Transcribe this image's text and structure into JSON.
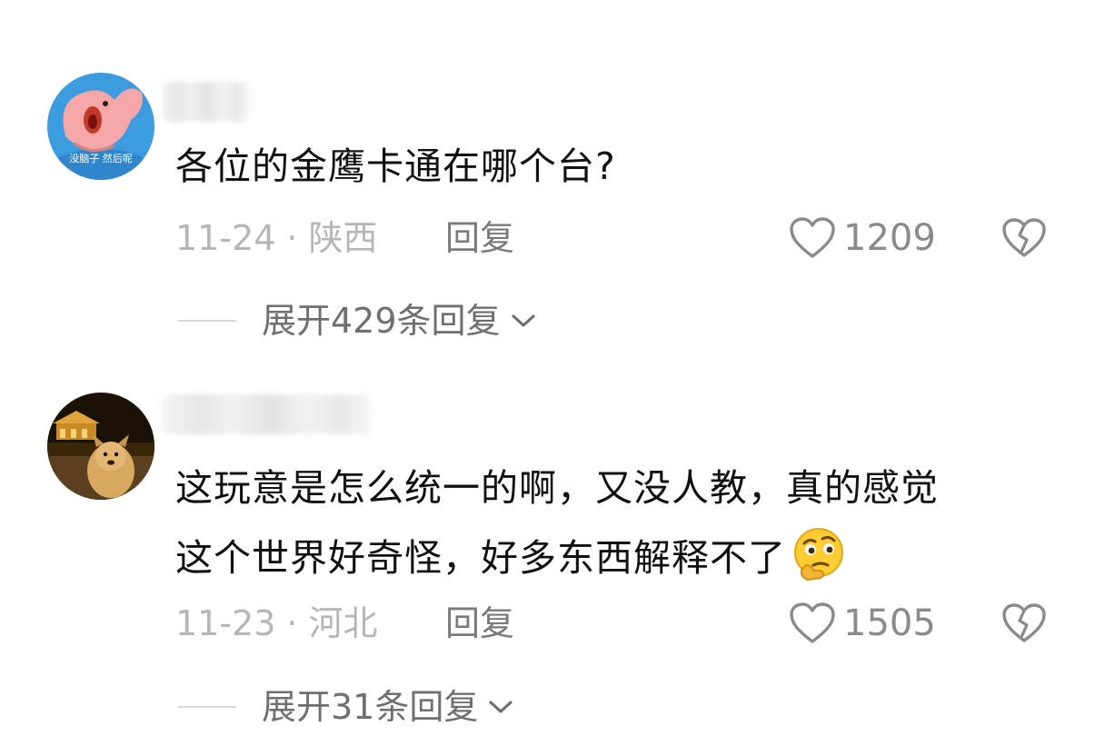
{
  "comments": [
    {
      "text": "各位的金鹰卡通在哪个台?",
      "date": "11-24",
      "separator": "·",
      "location": "陕西",
      "reply_label": "回复",
      "likes": "1209",
      "expand_label": "展开429条回复",
      "avatar_caption": "没脑子 然后呢"
    },
    {
      "text_line1": "这玩意是怎么统一的啊，又没人教，真的感觉",
      "text_line2": "这个世界好奇怪，好多东西解释不了",
      "date": "11-23",
      "separator": "·",
      "location": "河北",
      "reply_label": "回复",
      "likes": "1505",
      "expand_label": "展开31条回复"
    }
  ],
  "colors": {
    "text": "#111111",
    "meta": "#b6b6b6",
    "action": "#7a7a7a",
    "avatar1_bg": "#3d9be0",
    "avatar1_char": "#f5a6a6"
  },
  "icons": [
    "heart-outline-icon",
    "broken-heart-icon",
    "chevron-down-icon",
    "thinking-face-emoji"
  ]
}
